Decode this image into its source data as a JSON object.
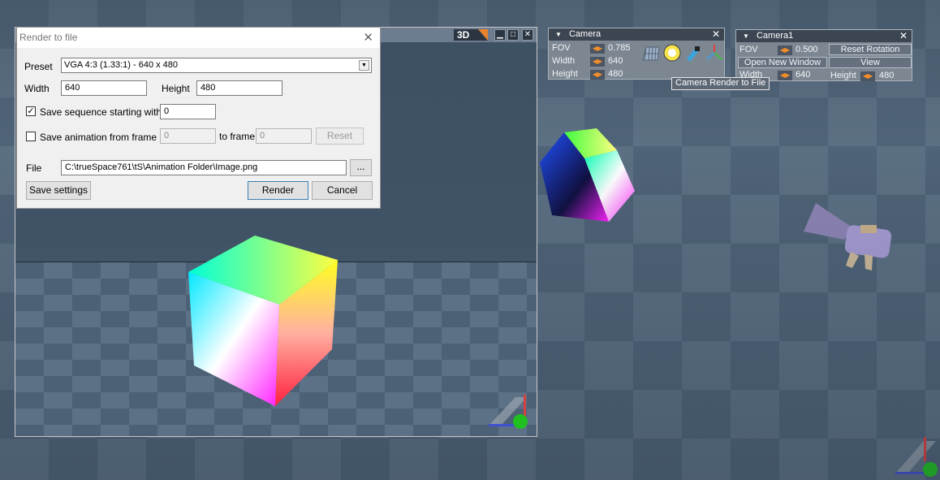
{
  "dialog": {
    "title": "Render to file",
    "close_glyph": "✕",
    "preset_label": "Preset",
    "preset_value": "VGA 4:3 (1.33:1) - 640 x 480",
    "width_label": "Width",
    "width_value": "640",
    "height_label": "Height",
    "height_value": "480",
    "save_sequence_label": "Save sequence starting with",
    "save_sequence_checked": true,
    "save_sequence_value": "0",
    "save_animation_label": "Save animation from frame",
    "save_animation_checked": false,
    "from_frame_value": "0",
    "to_frame_label": "to frame",
    "to_frame_value": "0",
    "reset_label": "Reset",
    "file_label": "File",
    "file_value": "C:\\trueSpace761\\tS\\Animation Folder\\Image.png",
    "browse_label": "...",
    "save_settings_label": "Save settings",
    "render_label": "Render",
    "cancel_label": "Cancel"
  },
  "viewport3d": {
    "badge": "3D",
    "minimize": "▁",
    "maximize": "□",
    "close": "✕"
  },
  "camera_panel": {
    "title": "Camera",
    "fov_label": "FOV",
    "fov_value": "0.785",
    "width_label": "Width",
    "width_value": "640",
    "height_label": "Height",
    "height_value": "480"
  },
  "camera1_panel": {
    "title": "Camera1",
    "fov_label": "FOV",
    "fov_value": "0.500",
    "reset_rotation_label": "Reset Rotation",
    "open_new_window_label": "Open New Window",
    "view_label": "View",
    "width_label": "Width",
    "width_value": "640",
    "height_label": "Height",
    "height_value": "480"
  },
  "tooltip": "Camera Render to File",
  "colors": {
    "accent_orange": "#e8822c",
    "panel_bg": "#7d8792",
    "dialog_bg": "#f0f0f0"
  }
}
